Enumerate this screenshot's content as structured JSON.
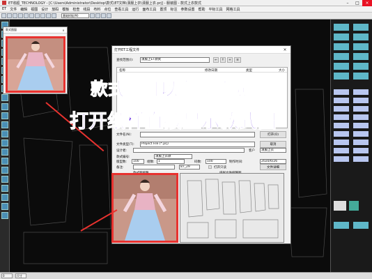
{
  "titlebar": {
    "text": "ET收超_TECHNOLOGY - [C:\\Users\\Administrator\\Desktop\\款式\\ET文档\\漢服上衣\\漢服上衣.prj] - 服装图 - 款式上衣款式"
  },
  "menu": [
    "ET",
    "文件",
    "编辑",
    "视图",
    "设计",
    "放码",
    "模板",
    "检查",
    "线段",
    "布料",
    "点位",
    "查看工具",
    "运行",
    "面布工具",
    "置顶",
    "标注",
    "参数设置",
    "帮助",
    "平标工具",
    "网格工具"
  ],
  "toolbar": {
    "layer_select": "基础样板(M)"
  },
  "preview_window": {
    "title": "款式图窗"
  },
  "dialog": {
    "title": "打开ET工程文件",
    "lookin_label": "查找范围(I):",
    "lookin_value": "漢服上ET款式",
    "col_name": "名称",
    "col_date": "修改日期",
    "col_type": "类型",
    "col_size": "大小",
    "filename_label": "文件名(N):",
    "filetype_label": "文件类型(T):",
    "filetype_value": "Project File (*.prj)",
    "open_btn": "打开(O)",
    "cancel_btn": "取消",
    "designer_label": "设计者:",
    "client_label": "客户",
    "client_value": "漢服上衣",
    "style_no_label": "款式编号:",
    "style_no_value": "漢服上衣款",
    "count_label": "版型数:",
    "count_value": "100",
    "group_label": "组数:",
    "group_value": "1",
    "size_label": "码数:",
    "size_value": "100",
    "time_label": "制作时间:",
    "time_value": "2020/6/26",
    "note_label": "备注:",
    "note_value": "87_29",
    "readonly_label": "打开只读",
    "detail_btn": "文件详细",
    "style_img_label": "款式图缩略",
    "paper_img_label": "纸样文件缩略图"
  },
  "overlay": {
    "line1": "款式图可以直接预览",
    "line2": "打开纸样直接显示款式图"
  },
  "status": {
    "cell1": "0",
    "cell2": "尺寸"
  },
  "colors": {
    "accent_red": "#e8322f",
    "headline_purple": "#5a1fe0",
    "canvas": "#0b0b0b"
  }
}
